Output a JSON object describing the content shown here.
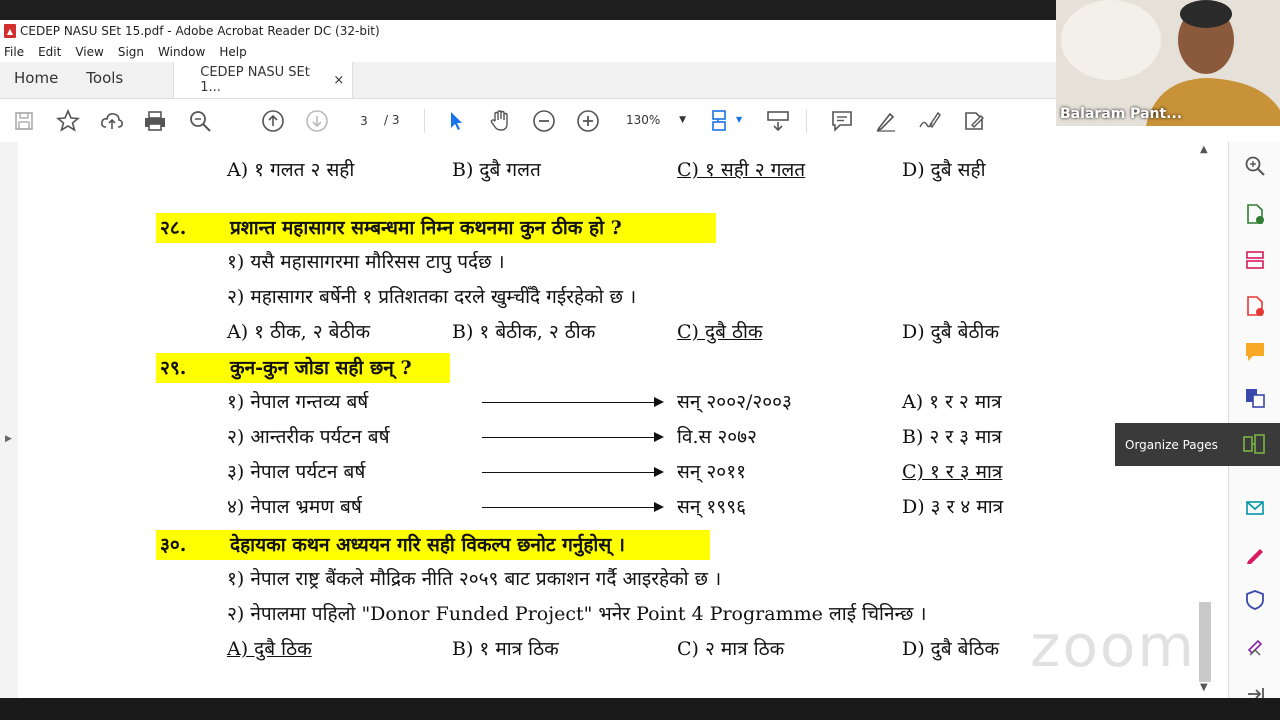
{
  "window": {
    "title": "CEDEP NASU SEt 15.pdf - Adobe Acrobat Reader DC (32-bit)"
  },
  "menu": [
    "File",
    "Edit",
    "View",
    "Sign",
    "Window",
    "Help"
  ],
  "tabs": {
    "home": "Home",
    "tools": "Tools",
    "document": "CEDEP NASU SEt 1...",
    "close": "×"
  },
  "toolbar": {
    "page_current": "3",
    "page_total": "/ 3",
    "zoom": "130%"
  },
  "tooltip": {
    "label": "Organize Pages"
  },
  "video": {
    "participant": "Balaram Pant..."
  },
  "watermark": "zoom",
  "document": {
    "top_options": {
      "a": "A) १ गलत २ सही",
      "b": "B) दुबै गलत",
      "c": "C) १ सही २ गलत",
      "d": "D) दुबै सही"
    },
    "q28": {
      "num": "२८.",
      "question": "प्रशान्त महासागर सम्बन्धमा निम्न कथनमा कुन ठीक हो ?",
      "s1": "१) यसै महासागरमा मौरिसस टापु पर्दछ ।",
      "s2": "२) महासागर बर्षेनी १ प्रतिशतका दरले खुम्चीँदै गईरहेको छ ।",
      "a": "A) १ ठीक, २ बेठीक",
      "b": "B) १ बेठीक, २ ठीक",
      "c": "C) दुबै ठीक",
      "d": "D) दुबै बेठीक"
    },
    "q29": {
      "num": "२९.",
      "question": "कुन-कुन जोडा सही छन् ?",
      "rows": [
        {
          "left": "१) नेपाल गन्तव्य बर्ष",
          "right": "सन् २००२/२००३",
          "opt": "A) १ र २ मात्र"
        },
        {
          "left": "२) आन्तरीक पर्यटन बर्ष",
          "right": "वि.स २०७२",
          "opt": "B) २ र ३ मात्र"
        },
        {
          "left": "३) नेपाल पर्यटन बर्ष",
          "right": "सन् २०११",
          "opt": "C) १ र ३ मात्र"
        },
        {
          "left": "४) नेपाल भ्रमण बर्ष",
          "right": "सन् १९९६",
          "opt": "D) ३ र ४ मात्र"
        }
      ]
    },
    "q30": {
      "num": "३०.",
      "question": "देहायका कथन अध्ययन गरि सही विकल्प छनोट गर्नुहोस् ।",
      "s1": "१) नेपाल राष्ट्र बैंकले मौद्रिक नीति २०५९ बाट प्रकाशन गर्दै आइरहेको छ ।",
      "s2": "२) नेपालमा पहिलो \"Donor Funded Project\" भनेर Point 4 Programme लाई चिनिन्छ ।",
      "a": "A) दुबै ठिक",
      "b": "B) १ मात्र ठिक",
      "c": "C) २ मात्र ठिक",
      "d": "D) दुबै बेठिक"
    }
  }
}
